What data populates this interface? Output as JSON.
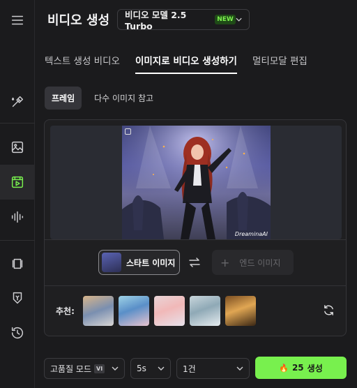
{
  "header": {
    "title": "비디오 생성",
    "model_select": {
      "value": "비디오 모델 2.5 Turbo",
      "badge": "NEW"
    }
  },
  "tabs": [
    {
      "label": "텍스트 생성 비디오",
      "active": false
    },
    {
      "label": "이미지로 비디오 생성하기",
      "active": true
    },
    {
      "label": "멀티모달 편집",
      "active": false
    }
  ],
  "subtabs": [
    {
      "label": "프레임",
      "active": true
    },
    {
      "label": "다수 이미지 참고",
      "active": false
    }
  ],
  "sidebar": {
    "icons": [
      "menu-icon",
      "magic-brush-icon",
      "image-icon",
      "video-icon",
      "audio-wave-icon",
      "canvas-icon",
      "brush-icon",
      "history-icon"
    ],
    "active": "video-icon"
  },
  "preview": {
    "watermark": "DreaminaAI"
  },
  "frames": {
    "start_label": "스타트 이미지",
    "end_label": "엔드 이미지"
  },
  "recommend": {
    "label": "추천:",
    "thumbnails": [
      "thumb-1",
      "thumb-2",
      "thumb-3",
      "thumb-4",
      "thumb-5"
    ]
  },
  "controls": {
    "quality": {
      "value": "고품질 모드",
      "badge": "VI"
    },
    "duration": {
      "value": "5s"
    },
    "count": {
      "value": "1건"
    },
    "generate": {
      "cost": "25",
      "label": "생성"
    }
  },
  "colors": {
    "accent": "#78f04e",
    "background": "#1b1b1d"
  }
}
